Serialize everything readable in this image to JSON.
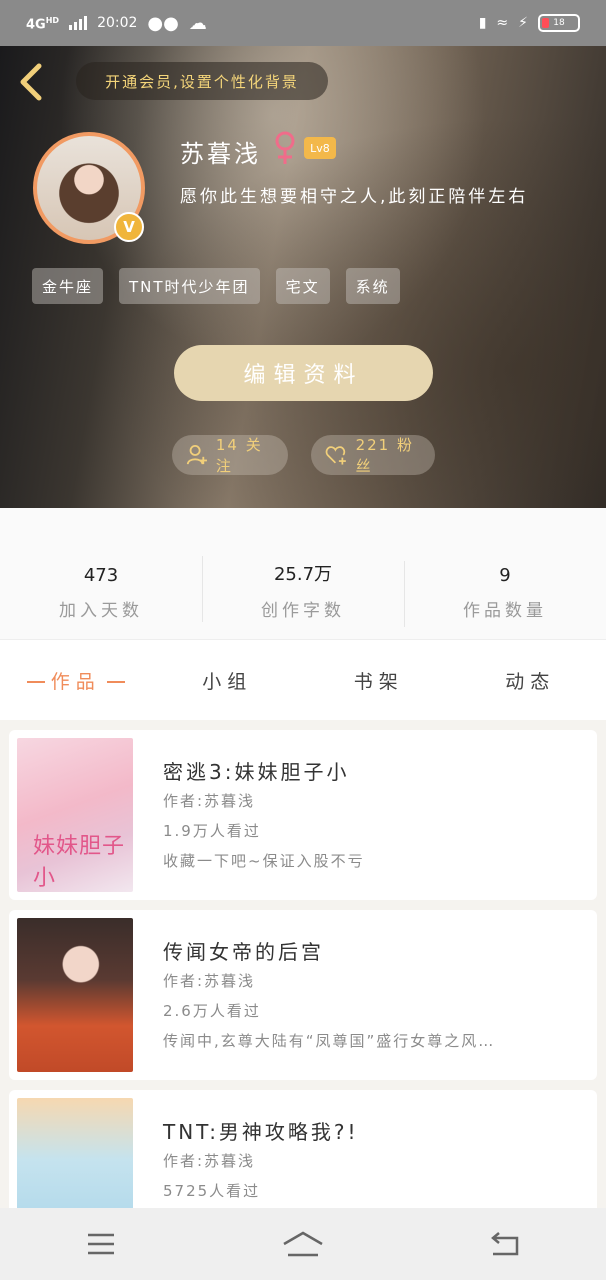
{
  "status_bar": {
    "network": "4G",
    "network_sup": "HD",
    "time": "20:02",
    "battery": "18"
  },
  "header": {
    "vip_banner": "开通会员,设置个性化背景",
    "username": "苏暮浅",
    "level": "Lv8",
    "verified_badge": "V",
    "signature": "愿你此生想要相守之人,此刻正陪伴左右",
    "tags": [
      "金牛座",
      "TNT时代少年团",
      "宅文",
      "系统"
    ],
    "edit_button": "编辑资料",
    "following_label": "14 关注",
    "fans_label": "221 粉丝",
    "accent_color": "#f1cf7a"
  },
  "stats": [
    {
      "value": "473",
      "label": "加入天数"
    },
    {
      "value": "25.7万",
      "label": "创作字数"
    },
    {
      "value": "9",
      "label": "作品数量"
    }
  ],
  "tabs": [
    {
      "label": "作品",
      "active": true
    },
    {
      "label": "小组",
      "active": false
    },
    {
      "label": "书架",
      "active": false
    },
    {
      "label": "动态",
      "active": false
    }
  ],
  "works": [
    {
      "title": "密逃3:妹妹胆子小",
      "author": "作者:苏暮浅",
      "views": "1.9万人看过",
      "desc": "收藏一下吧~保证入股不亏",
      "cover_text": "妹妹胆子小"
    },
    {
      "title": "传闻女帝的后宫",
      "author": "作者:苏暮浅",
      "views": "2.6万人看过",
      "desc": "传闻中,玄尊大陆有“凤尊国”盛行女尊之风…"
    },
    {
      "title": "TNT:男神攻略我?!",
      "author": "作者:苏暮浅",
      "views": "5725人看过"
    }
  ],
  "icons": {
    "back": "chevron-left-icon",
    "gender": "female-icon",
    "following": "add-user-icon",
    "fans": "heart-plus-icon",
    "nav": [
      "menu-icon",
      "home-icon",
      "back-arrow-icon"
    ]
  }
}
